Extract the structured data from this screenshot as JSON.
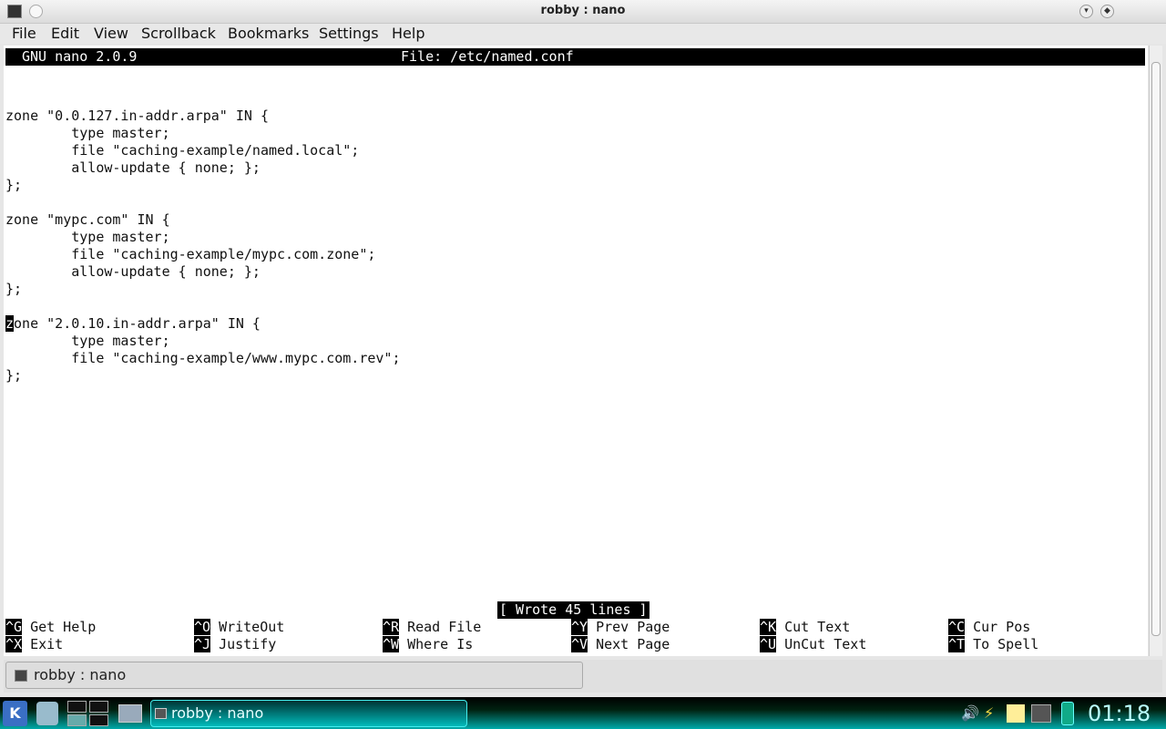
{
  "window": {
    "title": "robby : nano"
  },
  "menu": [
    "File",
    "Edit",
    "View",
    "Scrollback",
    "Bookmarks",
    "Settings",
    "Help"
  ],
  "nano": {
    "version": "GNU nano 2.0.9",
    "file": "File: /etc/named.conf",
    "lines": [
      "",
      "",
      "zone \"0.0.127.in-addr.arpa\" IN {",
      "        type master;",
      "        file \"caching-example/named.local\";",
      "        allow-update { none; };",
      "};",
      "",
      "zone \"mypc.com\" IN {",
      "        type master;",
      "        file \"caching-example/mypc.com.zone\";",
      "        allow-update { none; };",
      "};",
      "",
      "one \"2.0.10.in-addr.arpa\" IN {",
      "        type master;",
      "        file \"caching-example/www.mypc.com.rev\";",
      "};"
    ],
    "cursor_char": "z",
    "status": "[ Wrote 45 lines ]",
    "shortcuts": [
      [
        {
          "key": "^G",
          "label": "Get Help"
        },
        {
          "key": "^O",
          "label": "WriteOut"
        },
        {
          "key": "^R",
          "label": "Read File"
        },
        {
          "key": "^Y",
          "label": "Prev Page"
        },
        {
          "key": "^K",
          "label": "Cut Text"
        },
        {
          "key": "^C",
          "label": "Cur Pos"
        }
      ],
      [
        {
          "key": "^X",
          "label": "Exit"
        },
        {
          "key": "^J",
          "label": "Justify"
        },
        {
          "key": "^W",
          "label": "Where Is"
        },
        {
          "key": "^V",
          "label": "Next Page"
        },
        {
          "key": "^U",
          "label": "UnCut Text"
        },
        {
          "key": "^T",
          "label": "To Spell"
        }
      ]
    ]
  },
  "tab": {
    "label": "robby : nano"
  },
  "taskbar": {
    "task": "robby : nano",
    "clock": "01:18",
    "k_label": "K"
  }
}
